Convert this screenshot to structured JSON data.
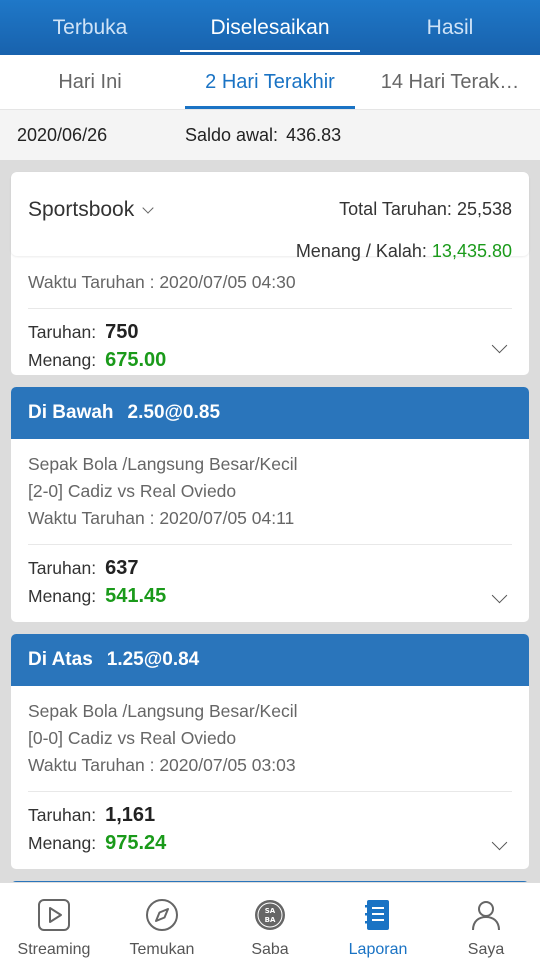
{
  "top_tabs": [
    "Terbuka",
    "Diselesaikan",
    "Hasil"
  ],
  "sub_tabs": [
    "Hari Ini",
    "2 Hari Terakhir",
    "14 Hari Terak…"
  ],
  "info": {
    "date": "2020/06/26",
    "balance_label": "Saldo awal:",
    "balance_value": "436.83"
  },
  "summary": {
    "product": "Sportsbook",
    "total_label": "Total Taruhan:",
    "total_value": "25,538",
    "winloss_label": "Menang / Kalah:",
    "winloss_value": "13,435.80"
  },
  "cards": [
    {
      "time": "Waktu Taruhan : 2020/07/05 04:30",
      "stake_label": "Taruhan:",
      "stake": "750",
      "win_label": "Menang:",
      "win": "675.00"
    },
    {
      "title": "Di Bawah",
      "odds": "2.50@0.85",
      "sport": "Sepak Bola /Langsung Besar/Kecil",
      "match": "[2-0] Cadiz vs Real Oviedo",
      "time": "Waktu Taruhan : 2020/07/05 04:11",
      "stake_label": "Taruhan:",
      "stake": "637",
      "win_label": "Menang:",
      "win": "541.45"
    },
    {
      "title": "Di Atas",
      "odds": "1.25@0.84",
      "sport": "Sepak Bola /Langsung Besar/Kecil",
      "match": "[0-0] Cadiz vs Real Oviedo",
      "time": "Waktu Taruhan : 2020/07/05 03:03",
      "stake_label": "Taruhan:",
      "stake": "1,161",
      "win_label": "Menang:",
      "win": "975.24"
    }
  ],
  "nav": [
    "Streaming",
    "Temukan",
    "Saba",
    "Laporan",
    "Saya"
  ],
  "colors": {
    "primary": "#1a73c4",
    "header": "#2a75bb",
    "win_green": "#1a9a1a"
  }
}
